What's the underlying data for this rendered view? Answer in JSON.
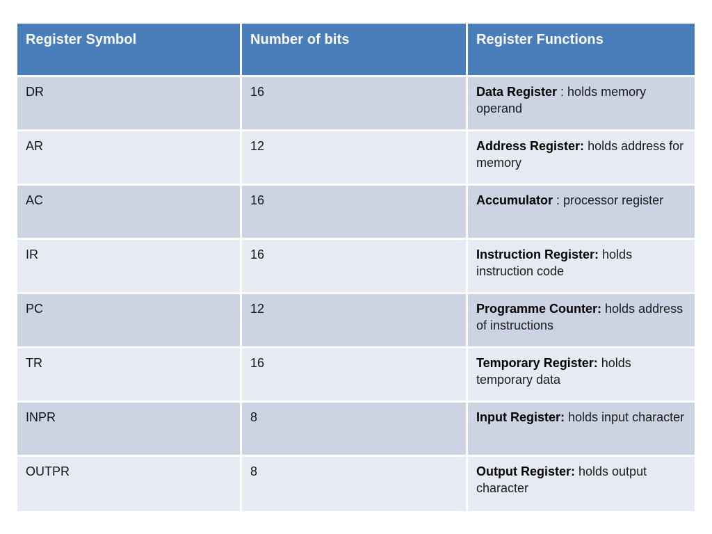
{
  "table": {
    "columns": [
      {
        "key": "symbol",
        "label": "Register Symbol"
      },
      {
        "key": "bits",
        "label": "Number of bits"
      },
      {
        "key": "function",
        "label": "Register Functions"
      }
    ],
    "header_bg": "#4a7ebb",
    "header_text_color": "#ffffff",
    "band_dark_bg": "#ccd3e3",
    "band_light_bg": "#e7eaf3",
    "rows": [
      {
        "symbol": "DR",
        "bits": "16",
        "function_name": "Data Register",
        "function_desc": " : holds memory operand"
      },
      {
        "symbol": "AR",
        "bits": "12",
        "function_name": "Address Register:",
        "function_desc": " holds address for memory"
      },
      {
        "symbol": "AC",
        "bits": "16",
        "function_name": "Accumulator",
        "function_desc": " : processor register"
      },
      {
        "symbol": "IR",
        "bits": "16",
        "function_name": "Instruction Register:",
        "function_desc": " holds instruction code"
      },
      {
        "symbol": "PC",
        "bits": "12",
        "function_name": "Programme Counter:",
        "function_desc": " holds address of instructions"
      },
      {
        "symbol": "TR",
        "bits": "16",
        "function_name": "Temporary Register:",
        "function_desc": " holds temporary data"
      },
      {
        "symbol": "INPR",
        "bits": "8",
        "function_name": "Input Register:",
        "function_desc": " holds input character"
      },
      {
        "symbol": "OUTPR",
        "bits": "8",
        "function_name": "Output Register:",
        "function_desc": " holds output character"
      }
    ]
  }
}
